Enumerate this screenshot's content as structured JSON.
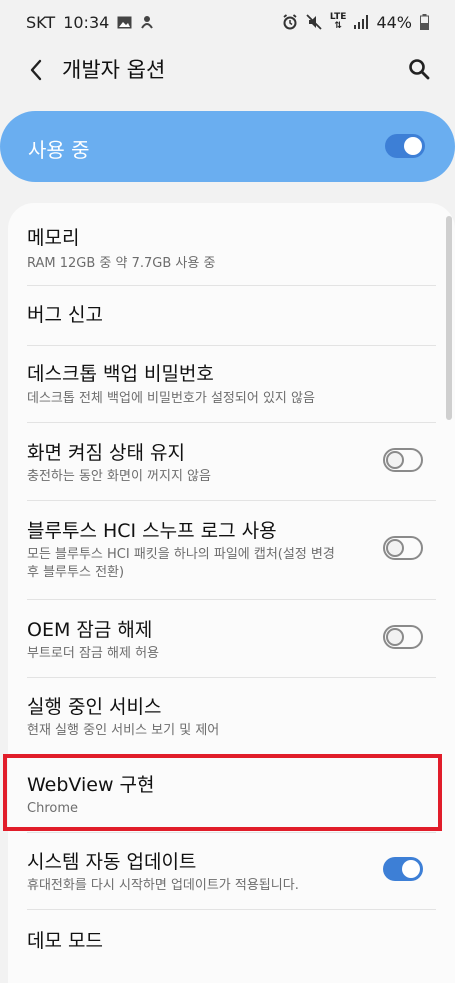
{
  "status_bar": {
    "carrier": "SKT",
    "time": "10:34",
    "network": "LTE",
    "battery": "44%"
  },
  "header": {
    "title": "개발자 옵션"
  },
  "master_switch": {
    "label": "사용 중",
    "enabled": true
  },
  "settings": [
    {
      "title": "메모리",
      "subtitle": "RAM 12GB 중 약 7.7GB 사용 중"
    },
    {
      "title": "버그 신고",
      "subtitle": ""
    },
    {
      "title": "데스크톱 백업 비밀번호",
      "subtitle": "데스크톱 전체 백업에 비밀번호가 설정되어 있지 않음"
    },
    {
      "title": "화면 켜짐 상태 유지",
      "subtitle": "충전하는 동안 화면이 꺼지지 않음",
      "toggle": "off"
    },
    {
      "title": "블루투스 HCI 스누프 로그 사용",
      "subtitle": "모든 블루투스 HCI 패킷을 하나의 파일에 캡처(설정 변경",
      "subtitle2": "후 블루투스 전환)",
      "toggle": "off"
    },
    {
      "title": "OEM 잠금 해제",
      "subtitle": "부트로더 잠금 해제 허용",
      "toggle": "off"
    },
    {
      "title": "실행 중인 서비스",
      "subtitle": "현재 실행 중인 서비스 보기 및 제어"
    },
    {
      "title": "WebView 구현",
      "subtitle": "Chrome"
    },
    {
      "title": "시스템 자동 업데이트",
      "subtitle": "휴대전화를 다시 시작하면 업데이트가 적용됩니다.",
      "toggle": "on"
    },
    {
      "title": "데모 모드",
      "subtitle": ""
    }
  ],
  "colors": {
    "accent": "#3d7fd6",
    "master_bg": "#6aaef0",
    "highlight": "#e11d2a"
  }
}
